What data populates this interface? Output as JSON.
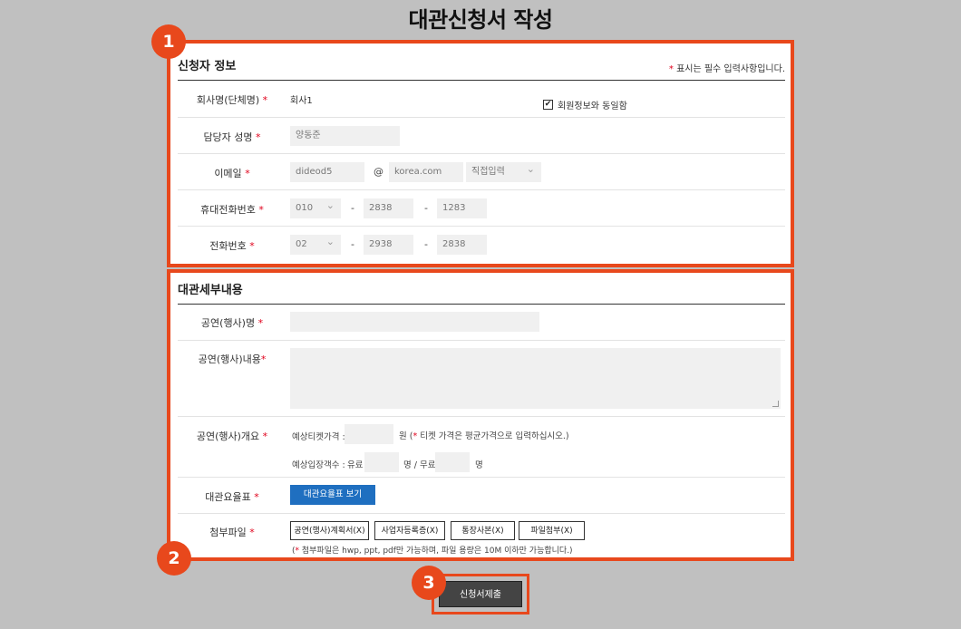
{
  "page_title": "대관신청서 작성",
  "markers": [
    "1",
    "2",
    "3"
  ],
  "applicant": {
    "section_title": "신청자 정보",
    "required_note": "표시는 필수 입력사항입니다.",
    "required_mark": "*",
    "company": {
      "label": "회사명(단체명)",
      "value": "회사1",
      "same_as_member": "회원정보와 동일함",
      "checked": "✔"
    },
    "manager": {
      "label": "담당자 성명",
      "value": "양동준"
    },
    "email": {
      "label": "이메일",
      "id": "dideod5",
      "at": "@",
      "domain": "korea.com",
      "domain_select": "직접입력"
    },
    "mobile": {
      "label": "휴대전화번호",
      "p1": "010",
      "p2": "2838",
      "p3": "1283",
      "dash": "-"
    },
    "phone": {
      "label": "전화번호",
      "p1": "02",
      "p2": "2938",
      "p3": "2838",
      "dash": "-"
    }
  },
  "details": {
    "section_title": "대관세부내용",
    "event_name": {
      "label": "공연(행사)명",
      "value": ""
    },
    "event_content": {
      "label": "공연(행사)내용",
      "value": ""
    },
    "overview": {
      "label": "공연(행사)개요",
      "ticket_label": "예상티켓가격 :",
      "ticket_unit": "원",
      "ticket_note_pre": "(",
      "ticket_note": " 티켓 가격은 평균가격으로 입력하십시오.)",
      "attendance_label": "예상입장객수 :",
      "paid": "유료",
      "paid_unit": "명 / 무료",
      "free_unit": "명"
    },
    "fee_table": {
      "label": "대관요율표",
      "button": "대관요율표 보기"
    },
    "attachments": {
      "label": "첨부파일",
      "buttons": [
        "공연(행사)계획서(X)",
        "사업자등록증(X)",
        "통장사본(X)",
        "파일첨부(X)"
      ],
      "note": " 첨부파일은 hwp, ppt, pdf만 가능하며, 파일 용량은 10M 이하만 가능합니다.)"
    }
  },
  "submit_label": "신청서제출",
  "colors": {
    "accent": "#e8481c",
    "blue_button": "#1f6fc0",
    "required": "#e0001b"
  }
}
